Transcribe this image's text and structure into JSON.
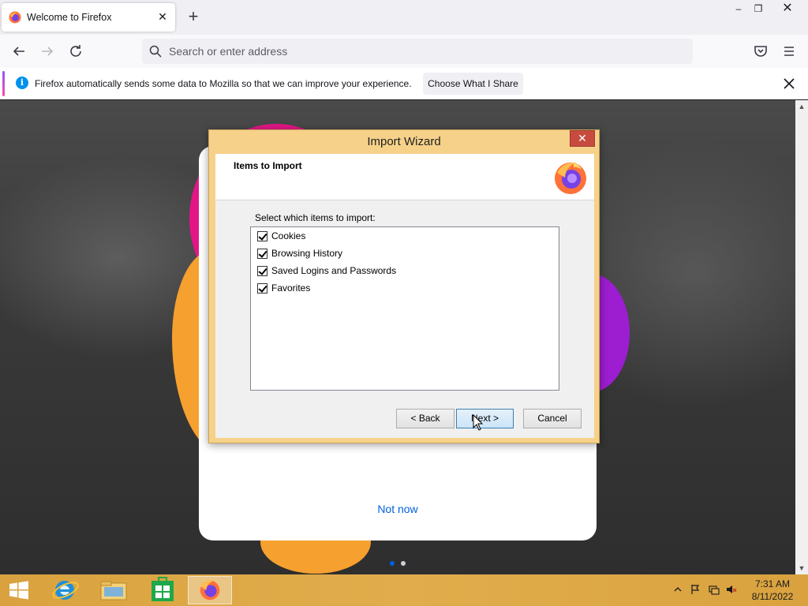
{
  "tab": {
    "title": "Welcome to Firefox"
  },
  "window_controls": {
    "minimize": "–",
    "maximize": "❐",
    "close": "✕"
  },
  "navbar": {
    "search_placeholder": "Search or enter address"
  },
  "notification": {
    "text": "Firefox automatically sends some data to Mozilla so that we can improve your experience.",
    "button_label": "Choose What I Share"
  },
  "page": {
    "not_now": "Not now",
    "pager": [
      "active",
      "inactive"
    ]
  },
  "dialog": {
    "title": "Import Wizard",
    "close": "✕",
    "header_title": "Items to Import",
    "prompt": "Select which items to import:",
    "items": [
      {
        "label": "Cookies",
        "checked": true
      },
      {
        "label": "Browsing History",
        "checked": true
      },
      {
        "label": "Saved Logins and Passwords",
        "checked": true
      },
      {
        "label": "Favorites",
        "checked": true
      }
    ],
    "buttons": {
      "back": "< Back",
      "next": "Next >",
      "cancel": "Cancel"
    }
  },
  "taskbar": {
    "clock_time": "7:31 AM",
    "clock_date": "8/11/2022",
    "pinned": [
      "windows-start-icon",
      "internet-explorer-icon",
      "file-explorer-icon",
      "store-icon",
      "firefox-icon"
    ]
  },
  "colors": {
    "accent_blue": "#0060df",
    "taskbar": "#d9a23f",
    "dialog_frame": "#f6d189",
    "brand_pink": "#e31587"
  }
}
